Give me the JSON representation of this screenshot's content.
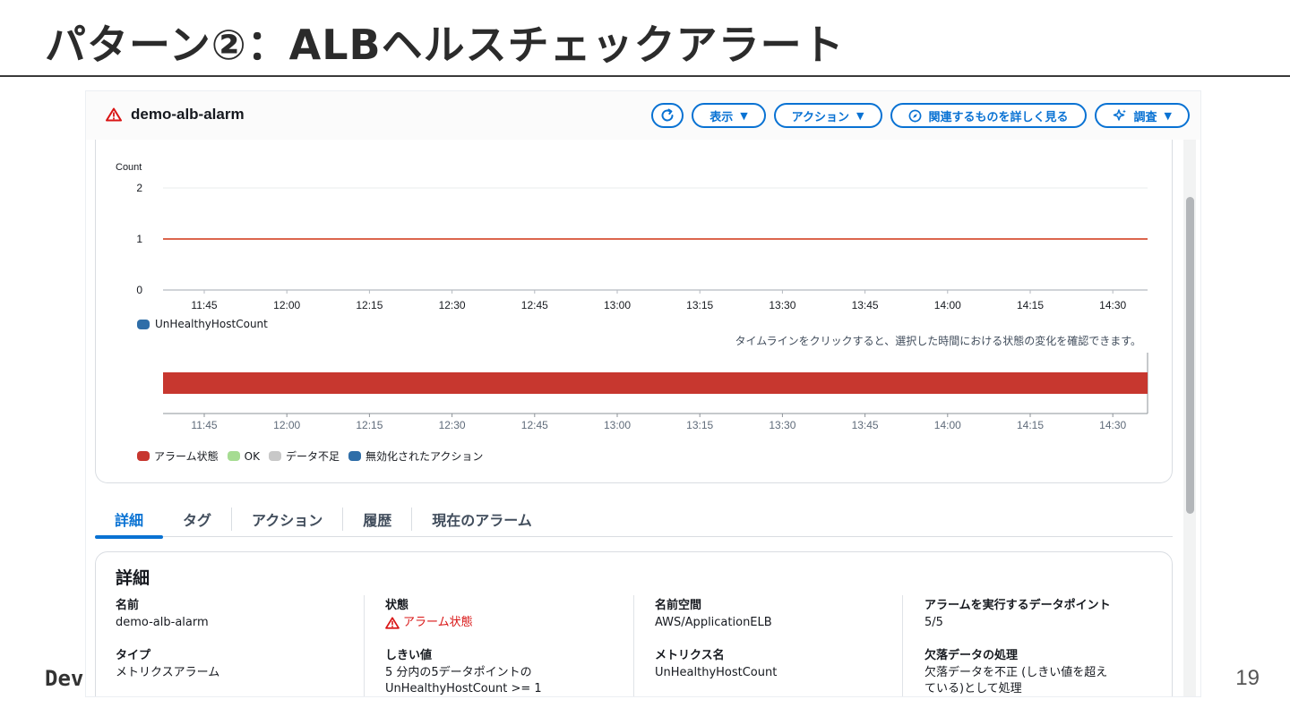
{
  "slide": {
    "title": "パターン②：ALBヘルスチェックアラート",
    "footer_brand": "Dev",
    "page_number": "19"
  },
  "alarm": {
    "name": "demo-alb-alarm",
    "toolbar": {
      "view_label": "表示",
      "actions_label": "アクション",
      "related_label": "関連するものを詳しく見る",
      "investigate_label": "調査"
    }
  },
  "chart_data": [
    {
      "type": "line",
      "ylabel": "Count",
      "ylim": [
        0,
        2
      ],
      "y_ticks": [
        "2",
        "1",
        "0"
      ],
      "x": [
        "11:45",
        "12:00",
        "12:15",
        "12:30",
        "12:45",
        "13:00",
        "13:15",
        "13:30",
        "13:45",
        "14:00",
        "14:15",
        "14:30"
      ],
      "threshold": 1,
      "threshold_color": "#d13212",
      "series": [
        {
          "name": "UnHealthyHostCount",
          "color": "#2f6ea8",
          "values": []
        }
      ],
      "legend": "bottom-left",
      "grid": true
    },
    {
      "type": "bar",
      "x": [
        "11:45",
        "12:00",
        "12:15",
        "12:30",
        "12:45",
        "13:00",
        "13:15",
        "13:30",
        "13:45",
        "14:00",
        "14:15",
        "14:30"
      ],
      "state_bar": {
        "state": "アラーム状態",
        "color": "#c7372f",
        "coverage": 1.0
      },
      "note": "タイムラインをクリックすると、選択した時間における状態の変化を確認できます。",
      "legend_items": [
        {
          "label": "アラーム状態",
          "color": "#c7372f"
        },
        {
          "label": "OK",
          "color": "#a6dc92"
        },
        {
          "label": "データ不足",
          "color": "#c8c8c8"
        },
        {
          "label": "無効化されたアクション",
          "color": "#2f6ea8"
        }
      ]
    }
  ],
  "tabs": [
    "詳細",
    "タグ",
    "アクション",
    "履歴",
    "現在のアラーム"
  ],
  "details": {
    "heading": "詳細",
    "name_label": "名前",
    "name_value": "demo-alb-alarm",
    "type_label": "タイプ",
    "type_value": "メトリクスアラーム",
    "state_label": "状態",
    "state_value": "アラーム状態",
    "threshold_label": "しきい値",
    "threshold_value_line1": "5 分内の5データポイントの",
    "threshold_value_line2": "UnHealthyHostCount >= 1",
    "namespace_label": "名前空間",
    "namespace_value": "AWS/ApplicationELB",
    "metric_label": "メトリクス名",
    "metric_value": "UnHealthyHostCount",
    "datapoints_label": "アラームを実行するデータポイント",
    "datapoints_value": "5/5",
    "missing_label": "欠落データの処理",
    "missing_value_line1": "欠落データを不正 (しきい値を超え",
    "missing_value_line2": "ている)として処理"
  }
}
